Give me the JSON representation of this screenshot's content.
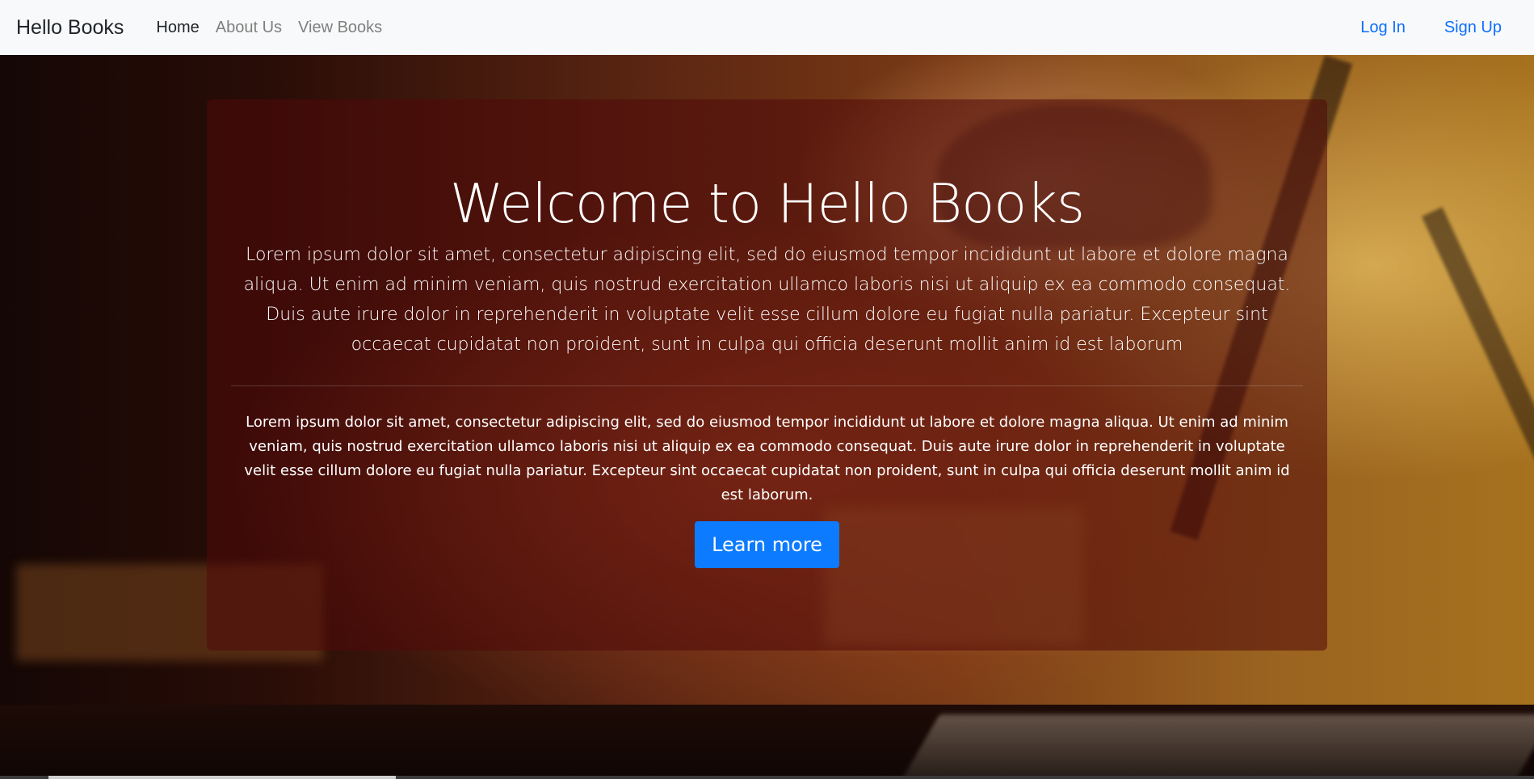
{
  "navbar": {
    "brand": "Hello Books",
    "links": [
      {
        "label": "Home",
        "active": true
      },
      {
        "label": "About Us",
        "active": false
      },
      {
        "label": "View Books",
        "active": false
      }
    ],
    "auth": [
      {
        "label": "Log In"
      },
      {
        "label": "Sign Up"
      }
    ]
  },
  "hero": {
    "heading": "Welcome to Hello Books",
    "lead": "Lorem ipsum dolor sit amet, consectetur adipiscing elit, sed do eiusmod tempor incididunt ut labore et dolore magna aliqua. Ut enim ad minim veniam, quis nostrud exercitation ullamco laboris nisi ut aliquip ex ea commodo consequat. Duis aute irure dolor in reprehenderit in voluptate velit esse cillum dolore eu fugiat nulla pariatur. Excepteur sint occaecat cupidatat non proident, sunt in culpa qui officia deserunt mollit anim id est laborum",
    "body": "Lorem ipsum dolor sit amet, consectetur adipiscing elit, sed do eiusmod tempor incididunt ut labore et dolore magna aliqua. Ut enim ad minim veniam, quis nostrud exercitation ullamco laboris nisi ut aliquip ex ea commodo consequat. Duis aute irure dolor in reprehenderit in voluptate velit esse cillum dolore eu fugiat nulla pariatur. Excepteur sint occaecat cupidatat non proident, sunt in culpa qui officia deserunt mollit anim id est laborum.",
    "button_label": "Learn more"
  },
  "colors": {
    "navbar_bg": "#f8f9fa",
    "nav_active": "#212529",
    "nav_inactive": "#7f7f7f",
    "auth_link": "#0d6efd",
    "primary_button": "#0d7bff",
    "card_overlay": "rgba(80,10,10,0.55)"
  }
}
